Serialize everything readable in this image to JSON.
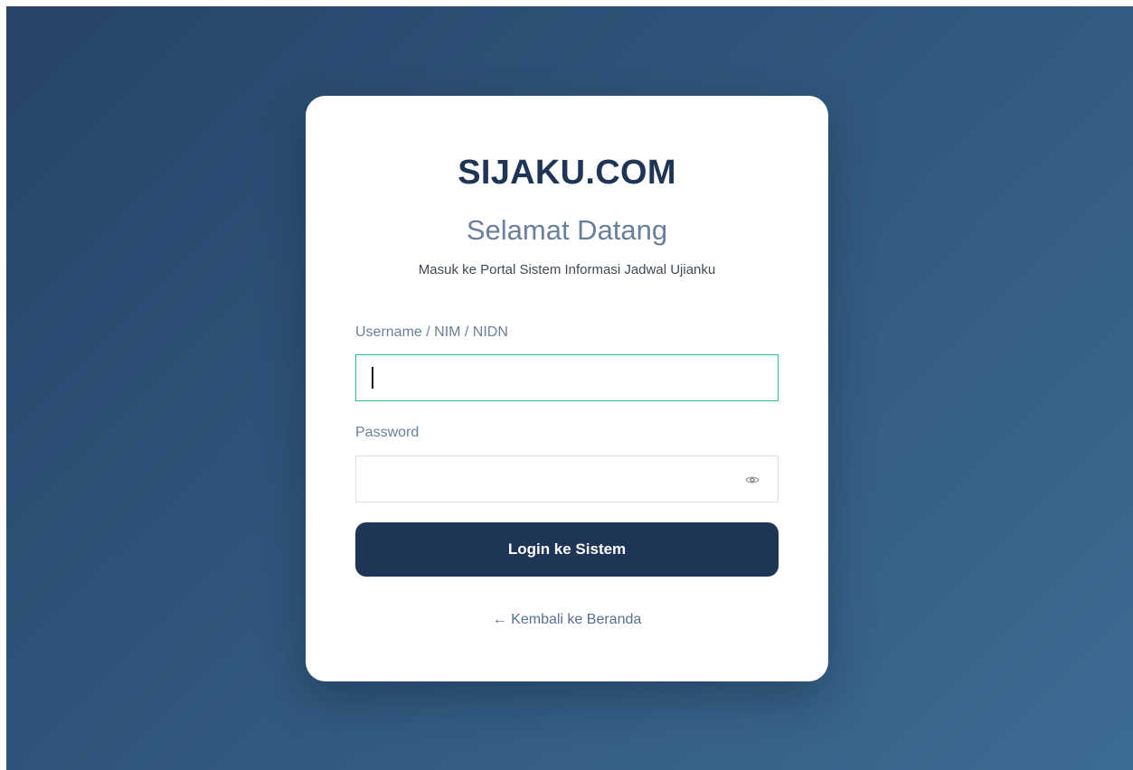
{
  "app": {
    "brand": "SIJAKU.COM",
    "welcome": "Selamat Datang",
    "subtitle": "Masuk ke Portal Sistem Informasi Jadwal Ujianku"
  },
  "form": {
    "username": {
      "label": "Username / NIM / NIDN",
      "value": "",
      "placeholder": ""
    },
    "password": {
      "label": "Password",
      "value": "",
      "placeholder": "",
      "toggle_icon": "eye-icon"
    },
    "submit_label": "Login ke Sistem",
    "back_link": "← Kembali ke Beranda"
  },
  "colors": {
    "primary": "#1f3556",
    "accent_focus": "#2fbf8f",
    "muted_text": "#6a7f9b",
    "background_start": "#27446a",
    "background_end": "#3d6c92"
  }
}
